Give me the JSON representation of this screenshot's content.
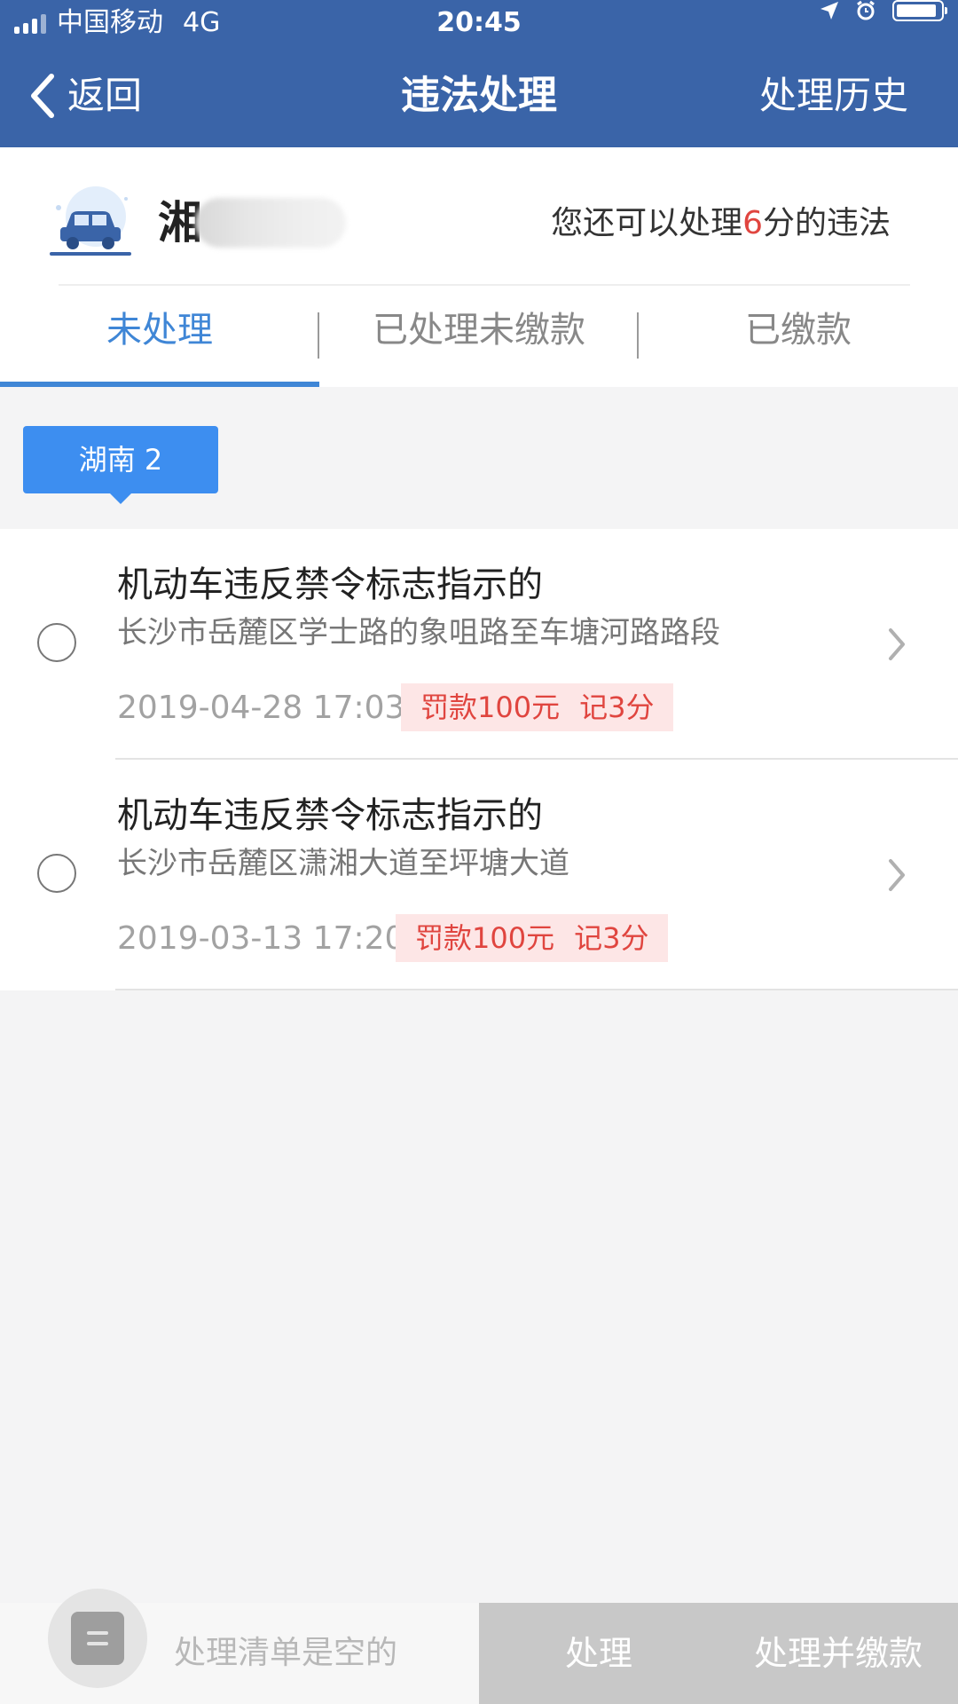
{
  "status_bar": {
    "carrier": "中国移动",
    "network": "4G",
    "time": "20:45"
  },
  "nav": {
    "back_label": "返回",
    "title": "违法处理",
    "history_label": "处理历史"
  },
  "vehicle": {
    "plate_prefix": "湘",
    "quota_prefix": "您还可以处理",
    "quota_points": "6",
    "quota_suffix": "分的违法"
  },
  "tabs": [
    {
      "label": "未处理",
      "active": true
    },
    {
      "label": "已处理未缴款",
      "active": false
    },
    {
      "label": "已缴款",
      "active": false
    }
  ],
  "region_tag": "湖南 2",
  "violations": [
    {
      "title": "机动车违反禁令标志指示的",
      "location": "长沙市岳麓区学士路的象咀路至车塘河路路段",
      "datetime": "2019-04-28 17:03",
      "fine": "罚款100元",
      "points": "记3分"
    },
    {
      "title": "机动车违反禁令标志指示的",
      "location": "长沙市岳麓区潇湘大道至坪塘大道",
      "datetime": "2019-03-13 17:20",
      "fine": "罚款100元",
      "points": "记3分"
    }
  ],
  "bottom_bar": {
    "cart_empty_text": "处理清单是空的",
    "process_label": "处理",
    "process_pay_label": "处理并缴款"
  },
  "colors": {
    "header_bg": "#3a64a8",
    "accent_blue": "#3f86d6",
    "tag_blue": "#3d8ef0",
    "warning_red": "#e0453f"
  }
}
